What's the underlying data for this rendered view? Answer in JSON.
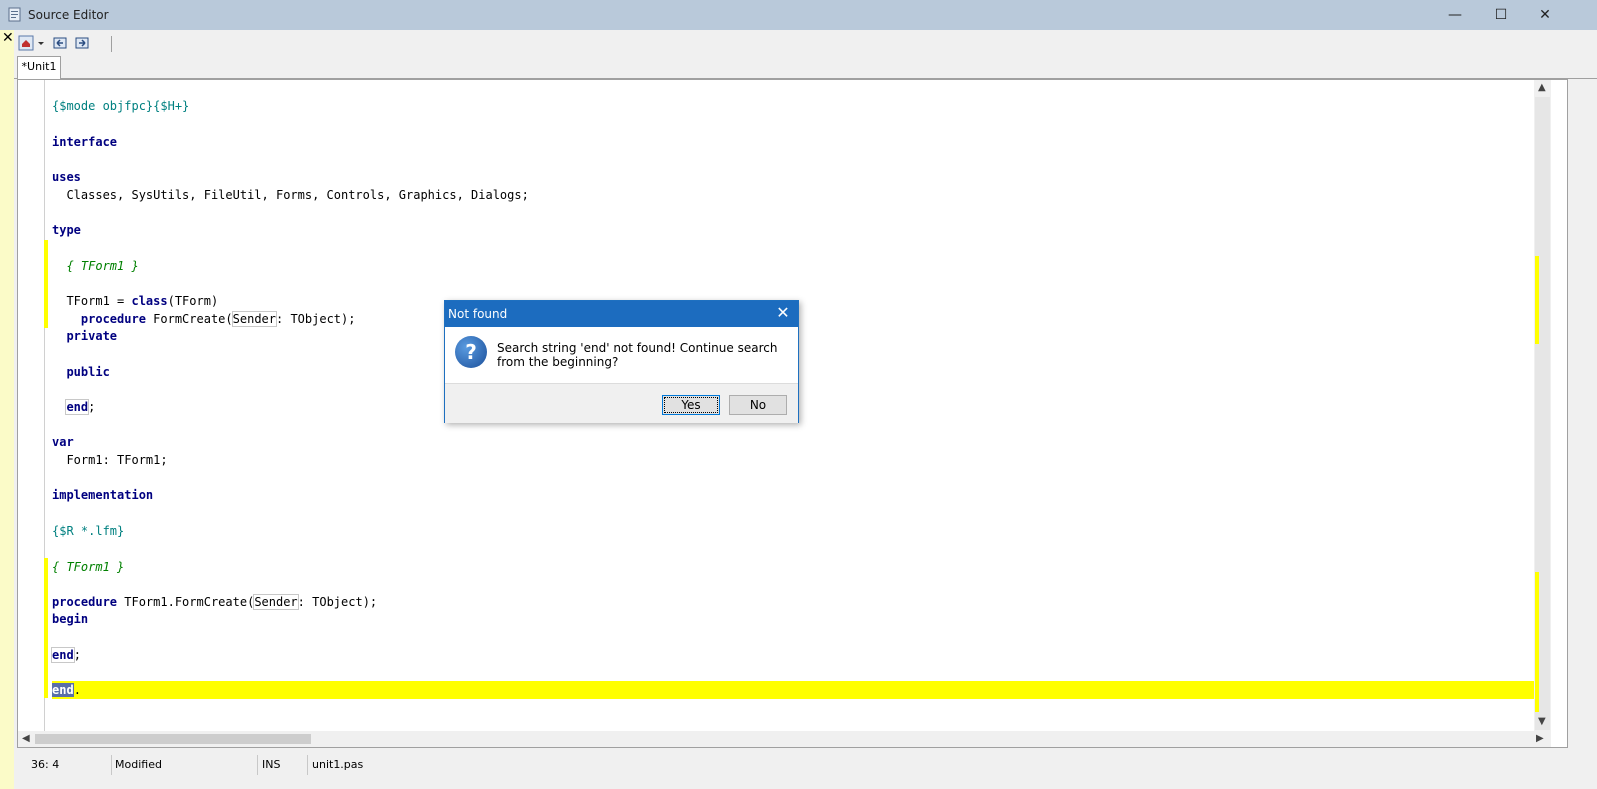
{
  "window": {
    "title": "Source Editor",
    "minimize_glyph": "—",
    "maximize_glyph": "☐",
    "close_glyph": "✕"
  },
  "sidebar": {
    "close_glyph": "✕"
  },
  "toolbar": {
    "icons": [
      "home-icon",
      "dropdown-arrow-icon",
      "jump-back-icon",
      "jump-forward-icon"
    ]
  },
  "tabs": [
    {
      "label": "*Unit1"
    }
  ],
  "editor": {
    "lines": [
      {
        "parts": [
          {
            "t": "{$mode objfpc}{$H+}",
            "c": "dir"
          }
        ]
      },
      {
        "parts": [
          {
            "t": "interface",
            "c": "kw"
          }
        ]
      },
      {
        "parts": [
          {
            "t": "uses",
            "c": "kw"
          }
        ]
      },
      {
        "parts": [
          {
            "t": "  Classes, SysUtils, FileUtil, Forms, Controls, Graphics, Dialogs;",
            "c": ""
          }
        ]
      },
      {
        "parts": [
          {
            "t": "type",
            "c": "kw"
          }
        ]
      },
      {
        "parts": [
          {
            "t": "  ",
            "c": ""
          },
          {
            "t": "{ TForm1 }",
            "c": "cmt"
          }
        ]
      },
      {
        "parts": [
          {
            "t": "  TForm1 = ",
            "c": ""
          },
          {
            "t": "class",
            "c": "kw"
          },
          {
            "t": "(TForm)",
            "c": ""
          }
        ]
      },
      {
        "parts": [
          {
            "t": "    ",
            "c": ""
          },
          {
            "t": "procedure",
            "c": "kw"
          },
          {
            "t": " FormCreate(",
            "c": ""
          },
          {
            "t": "Sender",
            "c": "boxed"
          },
          {
            "t": ": TObject);",
            "c": ""
          }
        ]
      },
      {
        "parts": [
          {
            "t": "  ",
            "c": ""
          },
          {
            "t": "private",
            "c": "kw"
          }
        ]
      },
      {
        "parts": [
          {
            "t": "  ",
            "c": ""
          },
          {
            "t": "public",
            "c": "kw"
          }
        ]
      },
      {
        "parts": [
          {
            "t": "  ",
            "c": ""
          },
          {
            "t": "end",
            "c": "kw boxed"
          },
          {
            "t": ";",
            "c": ""
          }
        ]
      },
      {
        "parts": [
          {
            "t": "var",
            "c": "kw"
          }
        ]
      },
      {
        "parts": [
          {
            "t": "  Form1: TForm1;",
            "c": ""
          }
        ]
      },
      {
        "parts": [
          {
            "t": "implementation",
            "c": "kw"
          }
        ]
      },
      {
        "parts": [
          {
            "t": "{$R *.lfm}",
            "c": "dir"
          }
        ]
      },
      {
        "parts": [
          {
            "t": "{ TForm1 }",
            "c": "cmt"
          }
        ]
      },
      {
        "parts": [
          {
            "t": "procedure",
            "c": "kw"
          },
          {
            "t": " TForm1.FormCreate(",
            "c": ""
          },
          {
            "t": "Sender",
            "c": "boxed"
          },
          {
            "t": ": TObject);",
            "c": ""
          }
        ]
      },
      {
        "parts": [
          {
            "t": "begin",
            "c": "kw"
          }
        ]
      },
      {
        "parts": [
          {
            "t": "end",
            "c": "kw boxed"
          },
          {
            "t": ";",
            "c": ""
          }
        ]
      },
      {
        "parts": [
          {
            "t": "end",
            "c": "kw sel"
          },
          {
            "t": ".",
            "c": ""
          }
        ]
      }
    ]
  },
  "statusbar": {
    "position": "36:  4",
    "modified": "Modified",
    "mode": "INS",
    "filename": "unit1.pas"
  },
  "dialog": {
    "title": "Not found",
    "message": "Search string 'end' not found! Continue search from the beginning?",
    "yes_label": "Yes",
    "no_label": "No",
    "icon": "question-icon",
    "close_glyph": "✕"
  },
  "colors": {
    "dialog_title_bg": "#1c6cbf",
    "current_line": "#ffff00",
    "keyword": "#000080",
    "directive": "#008080",
    "comment": "#008000"
  }
}
